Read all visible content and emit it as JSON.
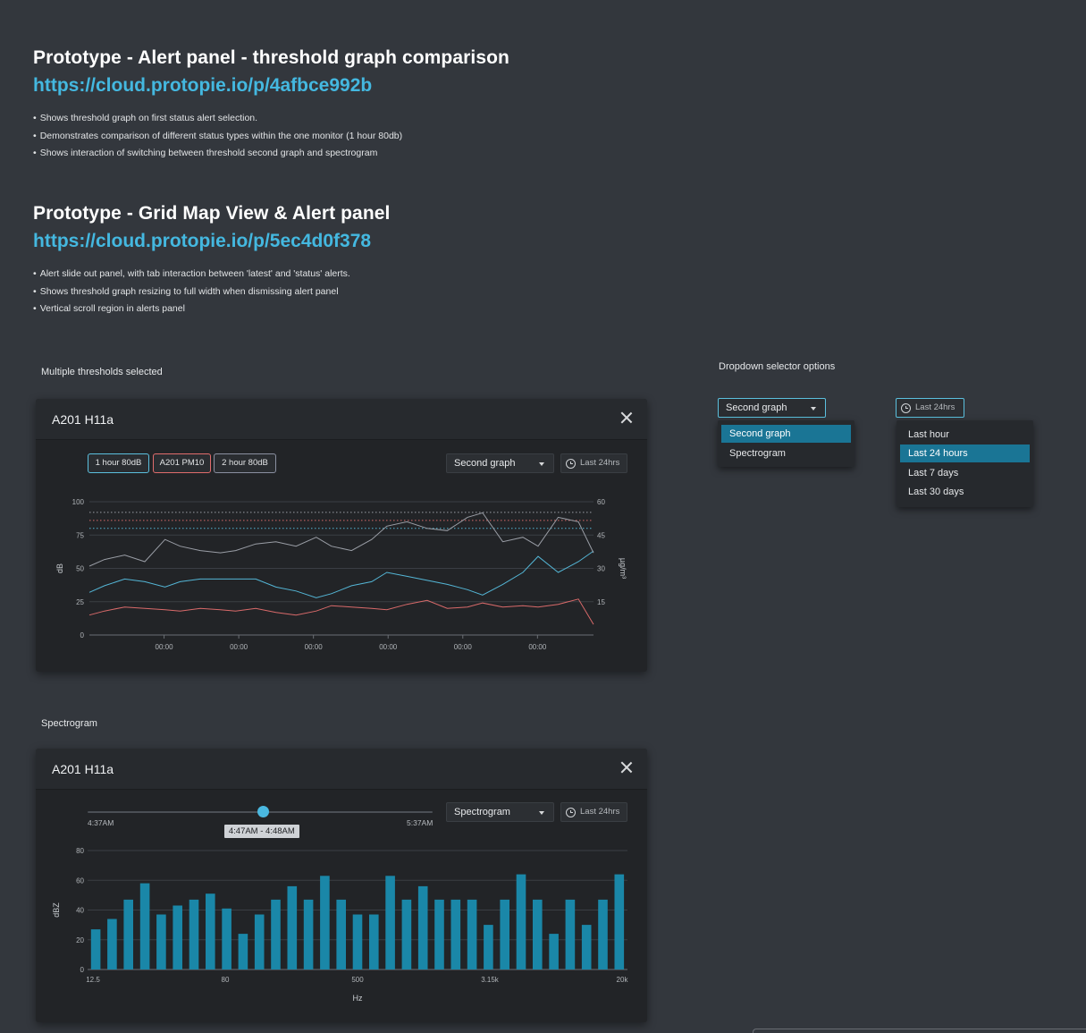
{
  "sections": [
    {
      "title": "Prototype - Alert panel - threshold graph comparison",
      "link": "https://cloud.protopie.io/p/4afbce992b",
      "bullets": [
        "Shows threshold graph on first status alert selection.",
        "Demonstrates comparison of different status types within the one monitor (1 hour 80db)",
        "Shows interaction of switching between threshold second graph and spectrogram"
      ]
    },
    {
      "title": "Prototype - Grid Map View & Alert panel",
      "link": "https://cloud.protopie.io/p/5ec4d0f378",
      "bullets": [
        "Alert slide out panel, with tab interaction between 'latest' and 'status' alerts.",
        "Shows threshold graph resizing to full width when dismissing alert panel",
        "Vertical scroll region in alerts panel"
      ]
    }
  ],
  "captions": {
    "thresholds": "Multiple thresholds selected",
    "dropdown": "Dropdown selector options",
    "spectrogram": "Spectrogram"
  },
  "threshold_panel": {
    "title": "A201 H11a",
    "chips": [
      "1 hour 80dB",
      "A201 PM10",
      "2 hour 80dB"
    ],
    "select_value": "Second graph",
    "time_label": "Last 24hrs"
  },
  "dropdowns": {
    "graph_select": {
      "value": "Second graph",
      "options": [
        "Second graph",
        "Spectrogram"
      ],
      "selected_index": 0
    },
    "time_select": {
      "value": "Last 24hrs",
      "options": [
        "Last hour",
        "Last 24 hours",
        "Last 7 days",
        "Last 30 days"
      ],
      "selected_index": 1
    }
  },
  "spectro_panel": {
    "title": "A201 H11a",
    "select_value": "Spectrogram",
    "time_label": "Last 24hrs",
    "slider": {
      "start": "4:37AM",
      "end": "5:37AM",
      "tooltip": "4:47AM - 4:48AM",
      "position": 0.51
    }
  },
  "colors": {
    "accent": "#5bc0de",
    "series_blue": "#54b6d6",
    "series_red": "#d96a6a",
    "series_grey": "#9a9ea6",
    "bar": "#1a87a8",
    "background": "#33373d",
    "panel": "#222427"
  },
  "icons": [
    "close-icon",
    "chevron-down-icon",
    "clock-icon"
  ],
  "chart_data": [
    {
      "type": "line",
      "ylabel": "dB",
      "ylabel_right": "µg/m³",
      "ylim": [
        0,
        100
      ],
      "ylim_right": [
        0,
        60
      ],
      "yticks": [
        "0",
        "25",
        "50",
        "75",
        "100"
      ],
      "yticks_right": [
        "15",
        "30",
        "45",
        "60"
      ],
      "xtick_labels": [
        "00:00",
        "00:00",
        "00:00",
        "00:00",
        "00:00",
        "00:00"
      ],
      "threshold_lines": [
        {
          "series": "2 hour 80dB",
          "value": 92,
          "color": "#9a9ea6",
          "style": "dotted"
        },
        {
          "series": "A201 PM10",
          "value": 86,
          "color": "#d96a6a",
          "style": "dotted"
        },
        {
          "series": "1 hour 80dB",
          "value": 80,
          "color": "#54b6d6",
          "style": "dotted"
        }
      ],
      "x": [
        0,
        3,
        7,
        11,
        15,
        18,
        22,
        26,
        29,
        33,
        37,
        41,
        45,
        48,
        52,
        56,
        59,
        63,
        67,
        71,
        75,
        78,
        82,
        86,
        89,
        93,
        97,
        100
      ],
      "series": [
        {
          "name": "1 hour 80dB",
          "color": "#54b6d6",
          "axis": "left",
          "values": [
            32,
            37,
            42,
            40,
            36,
            40,
            42,
            42,
            42,
            42,
            36,
            33,
            28,
            31,
            37,
            40,
            47,
            44,
            41,
            38,
            34,
            30,
            38,
            47,
            59,
            47,
            55,
            63
          ]
        },
        {
          "name": "A201 PM10",
          "color": "#d96a6a",
          "axis": "left",
          "values": [
            15,
            18,
            21,
            20,
            19,
            18,
            20,
            19,
            18,
            20,
            17,
            15,
            18,
            22,
            21,
            20,
            19,
            23,
            26,
            20,
            21,
            24,
            21,
            22,
            21,
            23,
            27,
            8
          ]
        },
        {
          "name": "2 hour 80dB",
          "color": "#9a9ea6",
          "axis": "right",
          "values": [
            31,
            34,
            36,
            33,
            43,
            40,
            38,
            37,
            38,
            41,
            42,
            40,
            44,
            40,
            38,
            43,
            49,
            51,
            48,
            47,
            53,
            55,
            42,
            44,
            40,
            53,
            51,
            37
          ]
        }
      ]
    },
    {
      "type": "bar",
      "xlabel": "Hz",
      "ylabel": "dBZ",
      "ylim": [
        0,
        80
      ],
      "yticks": [
        "0",
        "20",
        "40",
        "60",
        "80"
      ],
      "xtick_labels": [
        "12.5",
        "80",
        "500",
        "3.15k",
        "20k"
      ],
      "values": [
        27,
        34,
        47,
        58,
        37,
        43,
        47,
        51,
        41,
        24,
        37,
        47,
        56,
        47,
        63,
        47,
        37,
        37,
        63,
        47,
        56,
        47,
        47,
        47,
        30,
        47,
        64,
        47,
        24,
        47,
        30,
        47,
        64
      ]
    }
  ]
}
